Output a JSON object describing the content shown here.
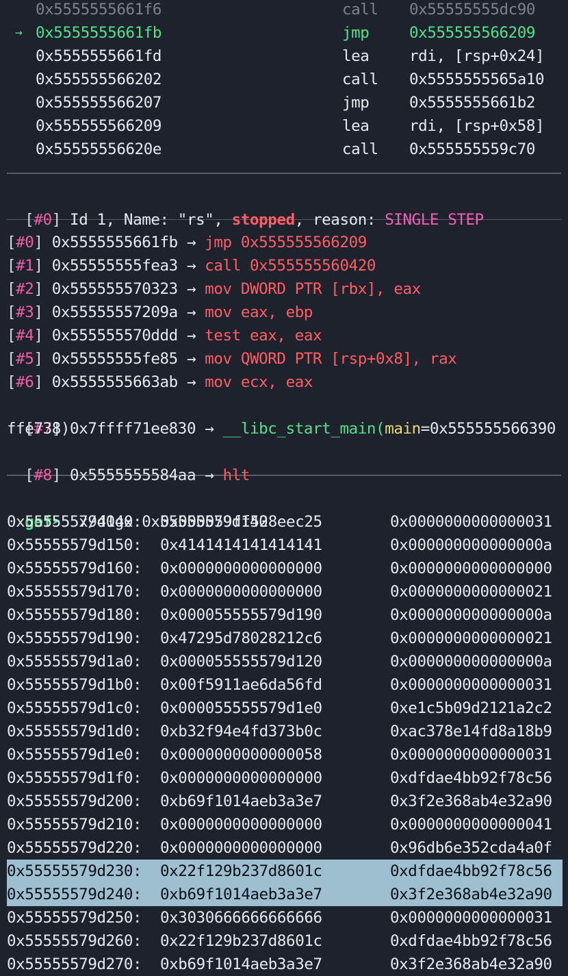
{
  "disasm": [
    {
      "addr": "0x5555555661f6",
      "op": "call",
      "arg": "0x55555555dc90",
      "state": "past"
    },
    {
      "addr": "0x5555555661fb",
      "op": "jmp",
      "arg": "0x555555566209",
      "state": "current",
      "marker": "→"
    },
    {
      "addr": "0x5555555661fd",
      "op": "lea",
      "arg": "rdi, [rsp+0x24]",
      "state": "next"
    },
    {
      "addr": "0x555555566202",
      "op": "call",
      "arg": "0x5555555565a10",
      "state": "next"
    },
    {
      "addr": "0x555555566207",
      "op": "jmp",
      "arg": "0x5555555661b2",
      "state": "next"
    },
    {
      "addr": "0x555555566209",
      "op": "lea",
      "arg": "rdi, [rsp+0x58]",
      "state": "next"
    },
    {
      "addr": "0x55555556620e",
      "op": "call",
      "arg": "0x555555559c70",
      "state": "next"
    }
  ],
  "thread": {
    "index": "#0",
    "prefix": " Id 1, Name: \"rs\", ",
    "status": "stopped",
    "mid": ", reason: ",
    "reason": "SINGLE STEP"
  },
  "trace": [
    {
      "idx": "#0",
      "addr": "0x5555555661fb",
      "ins": "jmp 0x555555566209"
    },
    {
      "idx": "#1",
      "addr": "0x55555555fea3",
      "ins": "call 0x555555560420"
    },
    {
      "idx": "#2",
      "addr": "0x555555570323",
      "ins": "mov DWORD PTR [rbx], eax"
    },
    {
      "idx": "#3",
      "addr": "0x55555557209a",
      "ins": "mov eax, ebp"
    },
    {
      "idx": "#4",
      "addr": "0x555555570ddd",
      "ins": "test eax, eax"
    },
    {
      "idx": "#5",
      "addr": "0x55555555fe85",
      "ins": "mov QWORD PTR [rsp+0x8], rax"
    },
    {
      "idx": "#6",
      "addr": "0x5555555663ab",
      "ins": "mov ecx, eax"
    }
  ],
  "trace_libc": {
    "idx": "#7",
    "addr": "0x7ffff71ee830",
    "func": "__libc_start_main(",
    "param": "main",
    "rest": "=0x555555566390",
    "wrap": "ffe738)"
  },
  "trace_last": {
    "idx": "#8",
    "addr": "0x5555555584aa",
    "ins": "hlt"
  },
  "arrow": "→",
  "prompt": {
    "label": "gef➤",
    "command": "  x/40gx 0x55555579d140"
  },
  "memory": [
    {
      "addr": "0x55555579d140:",
      "a": "0x000059ff528eec25",
      "b": "0x0000000000000031"
    },
    {
      "addr": "0x55555579d150:",
      "a": "0x4141414141414141",
      "b": "0x000000000000000a"
    },
    {
      "addr": "0x55555579d160:",
      "a": "0x0000000000000000",
      "b": "0x0000000000000000"
    },
    {
      "addr": "0x55555579d170:",
      "a": "0x0000000000000000",
      "b": "0x0000000000000021"
    },
    {
      "addr": "0x55555579d180:",
      "a": "0x000055555579d190",
      "b": "0x000000000000000a"
    },
    {
      "addr": "0x55555579d190:",
      "a": "0x47295d78028212c6",
      "b": "0x0000000000000021"
    },
    {
      "addr": "0x55555579d1a0:",
      "a": "0x000055555579d120",
      "b": "0x000000000000000a"
    },
    {
      "addr": "0x55555579d1b0:",
      "a": "0x00f5911ae6da56fd",
      "b": "0x0000000000000031"
    },
    {
      "addr": "0x55555579d1c0:",
      "a": "0x000055555579d1e0",
      "b": "0xe1c5b09d2121a2c2"
    },
    {
      "addr": "0x55555579d1d0:",
      "a": "0xb32f94e4fd373b0c",
      "b": "0xac378e14fd8a18b9"
    },
    {
      "addr": "0x55555579d1e0:",
      "a": "0x0000000000000058",
      "b": "0x0000000000000031"
    },
    {
      "addr": "0x55555579d1f0:",
      "a": "0x0000000000000000",
      "b": "0xdfdae4bb92f78c56"
    },
    {
      "addr": "0x55555579d200:",
      "a": "0xb69f1014aeb3a3e7",
      "b": "0x3f2e368ab4e32a90"
    },
    {
      "addr": "0x55555579d210:",
      "a": "0x0000000000000000",
      "b": "0x0000000000000041"
    },
    {
      "addr": "0x55555579d220:",
      "a": "0x0000000000000000",
      "b": "0x96db6e352cda4a0f"
    },
    {
      "addr": "0x55555579d230:",
      "a": "0x22f129b237d8601c",
      "b": "0xdfdae4bb92f78c56",
      "sel": true
    },
    {
      "addr": "0x55555579d240:",
      "a": "0xb69f1014aeb3a3e7",
      "b": "0x3f2e368ab4e32a90",
      "sel": true
    },
    {
      "addr": "0x55555579d250:",
      "a": "0x3030666666666666",
      "b": "0x0000000000000031"
    },
    {
      "addr": "0x55555579d260:",
      "a": "0x22f129b237d8601c",
      "b": "0xdfdae4bb92f78c56"
    },
    {
      "addr": "0x55555579d270:",
      "a": "0xb69f1014aeb3a3e7",
      "b": "0x3f2e368ab4e32a90"
    }
  ]
}
